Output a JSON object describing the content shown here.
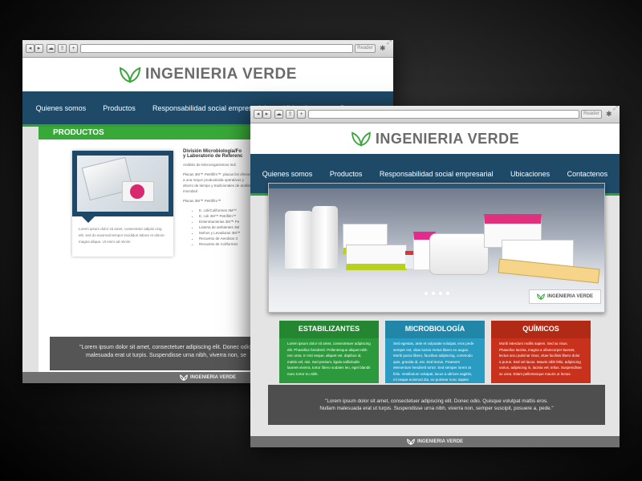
{
  "brand": {
    "name": "INGENIERIA VERDE",
    "colors": {
      "navy": "#1e4a68",
      "green": "#2fa02f",
      "teal": "#2b9cc1",
      "red": "#c8321c"
    }
  },
  "browser": {
    "reader_label": "Reader"
  },
  "nav": [
    "Quienes somos",
    "Productos",
    "Responsabilidad social empresarial",
    "Ubicaciones",
    "Contactenos"
  ],
  "back_page": {
    "section_title": "PRODUCTOS",
    "product_caption": "Lorem ipsum dolor sit amet, consectetur adipisi cing elit. sed do eiusmod tempor incididun labore et dolore magna aliqua. Ut enim ad minim",
    "division_title_1": "División Microbiología/Fo",
    "division_title_2": "y Laboratorio de Referenc",
    "analysis_line": "Análisis de Microorganismos Indi",
    "paragraph": "Placas 3M™ Petrifilm™: placas list ofrecerle a una mayor productivida operativos y ahorro de tiempo y tradicionales de análisis microbiol",
    "list_heading": "Placas 3M™ Petrifilm™",
    "bullets": [
      "E. coli/Coliformes 3M™",
      "E. coli 3M™ Petrifilm™",
      "Enterobacterias 3M™ Pe",
      "Listeria de ambientes 3M",
      "Mohos y Levaduras 3M™",
      "Recuento de Aerobios 3",
      "Recuento de Coliformes"
    ],
    "quote_line_1": "\"Lorem ipsum dolor sit amet, consectetuer adipiscing elit. Donec odio.",
    "quote_line_2": "malesuada erat ut turpis. Suspendisse urna nibh, viverra non, se"
  },
  "front_page": {
    "hero_logo_text": "INGENIERIA VERDE",
    "carousel_dots": 4,
    "columns": [
      {
        "title": "ESTABILIZANTES",
        "color": "#2c9a3c",
        "text": "Lorem ipsum dolor sit amet, consectetuer adipiscing elit. Phasellus hendrerit. Pellentesque aliquet nibh nec urna. In nisi neque, aliquet vel, dapibus id, mattis vel, nisi. Sed pretium, ligula sollicitudin laoreet viverra, tortor libero sodales leo, eget blandit nunc tortor eu nibh."
      },
      {
        "title": "MICROBIOLOGÍA",
        "color": "#2b9cc1",
        "text": "Sed egestas, ante et vulputate volutpat, eros pede semper est, vitae luctus metus libero eu augue. Morbi purus libero, faucibus adipiscing, commodo quis, gravida id, est. Sed lectus. Praesent elementum hendrerit tortor. Sed semper lorem at felis. Vestibulum volutpat, lacus a ultrices sagittis, mi neque euismod dui, eu pulvinar nunc sapien ornare nisl. Phasellus pede arcu, dapibus eu, fermentum et, dapibus sed, urna."
      },
      {
        "title": "QUÍMICOS",
        "color": "#c8321c",
        "text": "Morbi interdum mollis sapien. Sed ac risus. Phasellus lacinia, magna a ullamcorper laoreet, lectus arcu pulvinar risus, vitae facilisis libero dolor a purus. Sed vel lacus. Mauris nibh felis, adipiscing varius, adipiscing in, lacinia vel, tellus. Suspendisse ac urna. Etiam pellentesque mauris ut lectus."
      }
    ],
    "quote_line_1": "\"Lorem ipsum dolor sit amet, consectetuer adipiscing elit. Donec odio. Quisque volutpat mattis eros.",
    "quote_line_2": "Nullam malesuada erat ut turpis. Suspendisse urna nibh, viverra non, semper suscipit, posuere a, pede.\""
  }
}
